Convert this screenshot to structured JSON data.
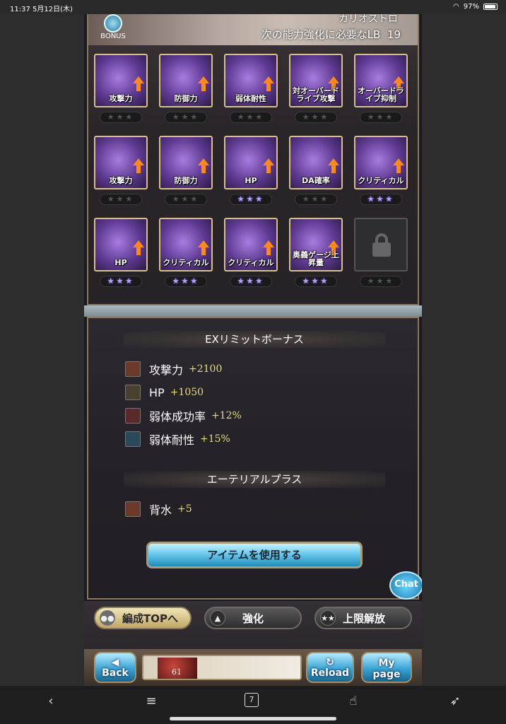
{
  "status": {
    "time": "11:37",
    "date": "5月12日(木)",
    "battery": "97%"
  },
  "header": {
    "bonus_label": "BONUS",
    "character_name": "カリオストロ",
    "lb_text": "次の能力強化に必要なLB",
    "lb_value": "19"
  },
  "limit_grid": [
    {
      "label": "攻撃力",
      "stars": "★★★",
      "active": false,
      "icon": "sword-icon"
    },
    {
      "label": "防御力",
      "stars": "★★★",
      "active": false,
      "icon": "shield-icon"
    },
    {
      "label": "弱体耐性",
      "stars": "★★★",
      "active": false,
      "icon": "person-icon"
    },
    {
      "label": "対オーバードライブ攻撃",
      "stars": "★★★",
      "active": false,
      "icon": "beast-icon"
    },
    {
      "label": "オーバードライブ抑制",
      "stars": "★★★",
      "active": false,
      "icon": "beast-icon"
    },
    {
      "label": "攻撃力",
      "stars": "★★★",
      "active": false,
      "icon": "sword-icon"
    },
    {
      "label": "防御力",
      "stars": "★★★",
      "active": false,
      "icon": "shield-icon"
    },
    {
      "label": "HP",
      "stars": "★★★",
      "active": true,
      "icon": "heart-icon"
    },
    {
      "label": "DA確率",
      "stars": "★★★",
      "active": false,
      "icon": "double-sword-icon"
    },
    {
      "label": "クリティカル",
      "stars": "★★★",
      "active": true,
      "icon": "burst-icon"
    },
    {
      "label": "HP",
      "stars": "★★★",
      "active": true,
      "icon": "heart-icon"
    },
    {
      "label": "クリティカル",
      "stars": "★★★",
      "active": true,
      "icon": "burst-icon"
    },
    {
      "label": "クリティカル",
      "stars": "★★★",
      "active": true,
      "icon": "burst-icon"
    },
    {
      "label": "奥義ゲージ上昇量",
      "stars": "★★★",
      "active": true,
      "icon": "gauge-icon"
    },
    {
      "label": "",
      "stars": "★★★",
      "active": false,
      "icon": "lock-icon"
    }
  ],
  "ex_bonus": {
    "title": "EXリミットボーナス",
    "items": [
      {
        "name": "攻撃力",
        "value": "+2100",
        "icon": "sword-icon"
      },
      {
        "name": "HP",
        "value": "+1050",
        "icon": "hp-icon"
      },
      {
        "name": "弱体成功率",
        "value": "+12%",
        "icon": "debuff-icon"
      },
      {
        "name": "弱体耐性",
        "value": "+15%",
        "icon": "resist-icon"
      }
    ]
  },
  "ethereal": {
    "title": "エーテリアルプラス",
    "items": [
      {
        "name": "背水",
        "value": "+5",
        "icon": "sword-icon"
      }
    ]
  },
  "buttons": {
    "use_item": "アイテムを使用する",
    "chat": "Chat",
    "tab_formation": "編成TOPへ",
    "tab_enhance": "強化",
    "tab_uncap": "上限解放",
    "back": "Back",
    "reload": "Reload",
    "mypage_1": "My",
    "mypage_2": "page",
    "banner_level": "61"
  },
  "bottom_bar": {
    "tab_count": "7"
  },
  "colors": {
    "accent_gold": "#d8c08a",
    "stat_value": "#e6dd7a",
    "arrow": "#ff8a14",
    "star_on": "#b8a4ff"
  }
}
